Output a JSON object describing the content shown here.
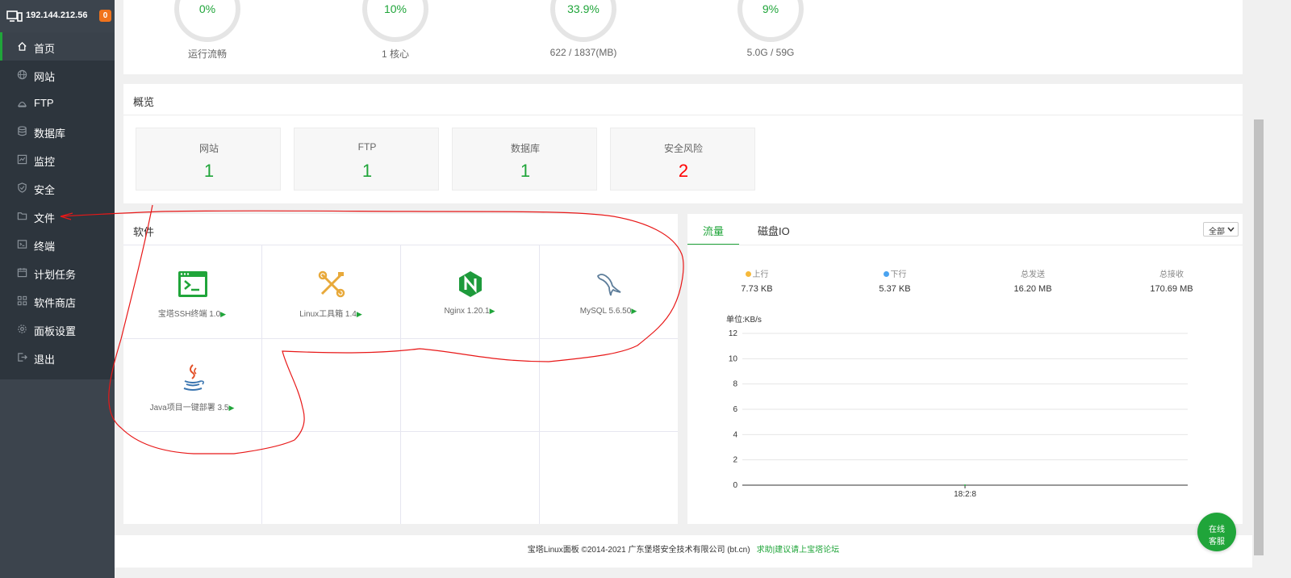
{
  "colors": {
    "accent": "#20a53a",
    "danger": "#ff0000",
    "sidebar": "#2d353d",
    "badge": "#f0731c"
  },
  "server": {
    "ip": "192.144.212.56",
    "badge": "0"
  },
  "menu": [
    {
      "label": "首页",
      "icon": "home-icon"
    },
    {
      "label": "网站",
      "icon": "globe-icon"
    },
    {
      "label": "FTP",
      "icon": "ftp-icon"
    },
    {
      "label": "数据库",
      "icon": "database-icon"
    },
    {
      "label": "监控",
      "icon": "monitor-icon"
    },
    {
      "label": "安全",
      "icon": "shield-icon"
    },
    {
      "label": "文件",
      "icon": "folder-icon"
    },
    {
      "label": "终端",
      "icon": "terminal-icon"
    },
    {
      "label": "计划任务",
      "icon": "calendar-icon"
    },
    {
      "label": "软件商店",
      "icon": "apps-icon"
    },
    {
      "label": "面板设置",
      "icon": "gear-icon"
    },
    {
      "label": "退出",
      "icon": "logout-icon"
    }
  ],
  "gauges": [
    {
      "value": "0%",
      "caption": "运行流畅"
    },
    {
      "value": "10%",
      "caption": "1 核心"
    },
    {
      "value": "33.9%",
      "caption": "622 / 1837(MB)"
    },
    {
      "value": "9%",
      "caption": "5.0G / 59G"
    }
  ],
  "overview": {
    "title": "概览",
    "cards": [
      {
        "label": "网站",
        "value": "1"
      },
      {
        "label": "FTP",
        "value": "1"
      },
      {
        "label": "数据库",
        "value": "1"
      },
      {
        "label": "安全风险",
        "value": "2"
      }
    ]
  },
  "software": {
    "title": "软件",
    "items": [
      {
        "name": "宝塔SSH终端 1.0",
        "icon": "ssh-terminal-icon"
      },
      {
        "name": "Linux工具箱 1.4",
        "icon": "toolbox-icon"
      },
      {
        "name": "Nginx 1.20.1",
        "icon": "nginx-icon"
      },
      {
        "name": "MySQL 5.6.50",
        "icon": "mysql-icon"
      },
      {
        "name": "Java项目一键部署 3.5",
        "icon": "java-icon"
      }
    ]
  },
  "traffic": {
    "tabs": [
      "流量",
      "磁盘IO"
    ],
    "select": "全部",
    "stats": [
      {
        "label": "上行",
        "value": "7.73 KB",
        "dot": "#f6b93b"
      },
      {
        "label": "下行",
        "value": "5.37 KB",
        "dot": "#4aa3f0"
      },
      {
        "label": "总发送",
        "value": "16.20 MB"
      },
      {
        "label": "总接收",
        "value": "170.69 MB"
      }
    ]
  },
  "chart_data": {
    "type": "line",
    "ylabel": "单位:KB/s",
    "yticks": [
      "12",
      "10",
      "8",
      "6",
      "4",
      "2",
      "0"
    ],
    "ylim": [
      0,
      12
    ],
    "categories": [
      "18:2:8"
    ],
    "series": [
      {
        "values": [
          0
        ]
      }
    ],
    "grid": true
  },
  "footer": {
    "text": "宝塔Linux面板 ©2014-2021 广东堡塔安全技术有限公司 (bt.cn)",
    "link": "求助|建议请上宝塔论坛"
  },
  "online": {
    "line1": "在线",
    "line2": "客服"
  }
}
